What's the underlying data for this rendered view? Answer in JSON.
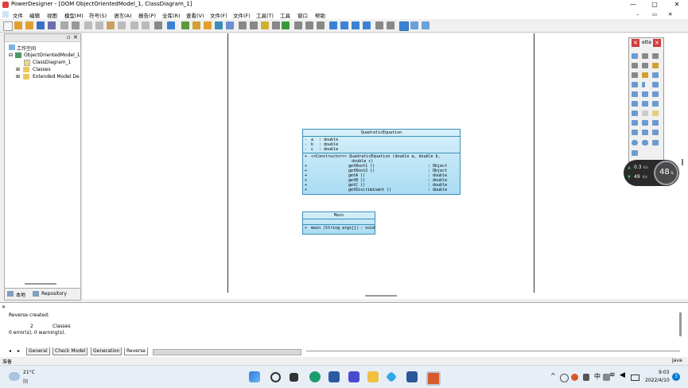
{
  "window": {
    "title": "PowerDesigner - [OOM ObjectOrientedModel_1, ClassDiagram_1]",
    "min": "—",
    "max": "▢",
    "close": "✕",
    "sub_min": "–",
    "sub_max": "▭",
    "sub_close": "✕"
  },
  "menu": [
    "文件",
    "编辑",
    "视图",
    "模型(M)",
    "符号(S)",
    "语言(A)",
    "报告(P)",
    "全库(R)",
    "查看(V)",
    "文件(F)",
    "文件(F)",
    "工具(T)",
    "工具",
    "窗口",
    "帮助"
  ],
  "browser": {
    "root": "工作空间",
    "model": "ObjectOrientedModel_1",
    "diagram": "ClassDiagram_1",
    "classes": "Classes",
    "extended": "Extended Model De",
    "tabs": [
      "本地",
      "Repository"
    ]
  },
  "classes": {
    "quadratic": {
      "name": "QuadraticEquation",
      "attributes": [
        {
          "vis": "-",
          "name": "a",
          "type": ": double"
        },
        {
          "vis": "-",
          "name": "b",
          "type": ": double"
        },
        {
          "vis": "-",
          "name": "c",
          "type": ": double"
        }
      ],
      "operations": [
        {
          "vis": "+",
          "name": "<<Constructor>> QuadraticEquation (double a, double b,",
          "ret": ""
        },
        {
          "vis": "",
          "name": "                 double c)",
          "ret": ""
        },
        {
          "vis": "+",
          "name": "getRoot1 ()",
          "ret": ": Object"
        },
        {
          "vis": "+",
          "name": "getRoot2 ()",
          "ret": ": Object"
        },
        {
          "vis": "+",
          "name": "getA ()",
          "ret": ": double"
        },
        {
          "vis": "+",
          "name": "getB ()",
          "ret": ": double"
        },
        {
          "vis": "+",
          "name": "getC ()",
          "ret": ": double"
        },
        {
          "vis": "+",
          "name": "getDiscriminant ()",
          "ret": ": double"
        }
      ]
    },
    "main": {
      "name": "Main",
      "operation": {
        "vis": "+",
        "name": "main (String args[])",
        "ret": ": void"
      }
    }
  },
  "palette": {
    "title": "ette",
    "close": "×"
  },
  "network": {
    "up": "0.3",
    "up_unit": "K/s",
    "down": "49",
    "down_unit": "K/s",
    "percent": "48",
    "percent_sign": "%"
  },
  "output": {
    "line1": "Reverse created:",
    "count": "2",
    "kind": "Classes",
    "summary": "0 error(s),  0 warning(s).",
    "tabs": [
      "General",
      "Check Model",
      "Generation",
      "Reverse"
    ]
  },
  "status": {
    "left": "准备",
    "right": "Java"
  },
  "taskbar": {
    "weather_temp": "21°C",
    "weather_desc": "阴",
    "ime": "中",
    "time": "9:03",
    "date": "2022/4/10",
    "notif": "3"
  },
  "colors": {
    "class_border": "#3a8fb8",
    "class_fill": "#bfe6f8",
    "palette_close": "#d23b3b",
    "accent": "#0078d4"
  }
}
